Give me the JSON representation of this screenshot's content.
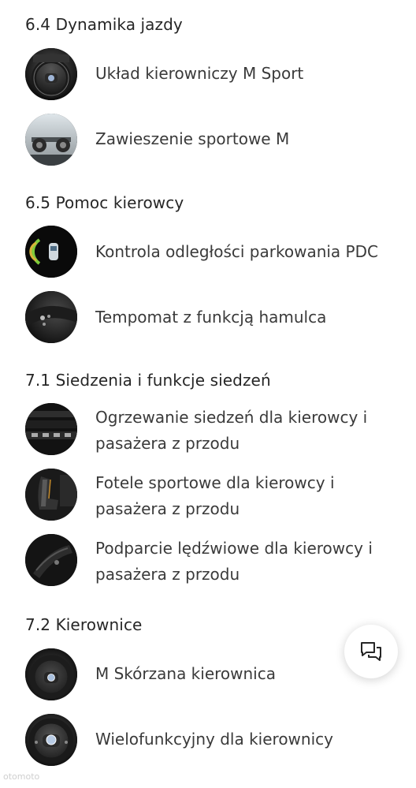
{
  "sections": [
    {
      "title": "6.4 Dynamika jazdy",
      "items": [
        {
          "label": "Układ kierowniczy M Sport",
          "icon": "steering-wheel-icon"
        },
        {
          "label": "Zawieszenie sportowe M",
          "icon": "suspension-icon"
        }
      ]
    },
    {
      "title": "6.5 Pomoc kierowcy",
      "items": [
        {
          "label": "Kontrola odległości parkowania PDC",
          "icon": "parking-sensor-icon"
        },
        {
          "label": "Tempomat z funkcją hamulca",
          "icon": "cruise-control-icon"
        }
      ]
    },
    {
      "title": "7.1 Siedzenia i funkcje siedzeń",
      "items": [
        {
          "label": "Ogrzewanie siedzeń dla kierowcy i pasażera z przodu",
          "icon": "seat-heating-icon"
        },
        {
          "label": "Fotele sportowe dla kierowcy i pasażera z przodu",
          "icon": "sport-seat-icon"
        },
        {
          "label": "Podparcie lędźwiowe dla kierowcy i pasażera z przodu",
          "icon": "lumbar-support-icon"
        }
      ]
    },
    {
      "title": "7.2 Kierownice",
      "items": [
        {
          "label": "M Skórzana kierownica",
          "icon": "leather-steering-wheel-icon"
        },
        {
          "label": "Wielofunkcyjny dla kierownicy",
          "icon": "multifunction-wheel-icon"
        }
      ]
    }
  ],
  "chat": {
    "icon": "chat-icon"
  },
  "watermark": "otomoto"
}
